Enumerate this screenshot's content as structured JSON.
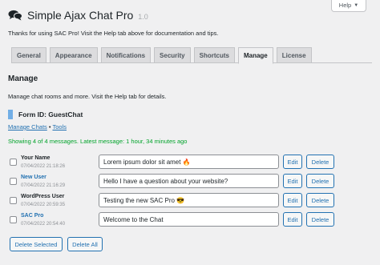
{
  "help_tab": {
    "label": "Help"
  },
  "header": {
    "title": "Simple Ajax Chat Pro",
    "version": "1.0",
    "intro": "Thanks for using SAC Pro! Visit the Help tab above for documentation and tips."
  },
  "tabs": [
    {
      "label": "General"
    },
    {
      "label": "Appearance"
    },
    {
      "label": "Notifications"
    },
    {
      "label": "Security"
    },
    {
      "label": "Shortcuts"
    },
    {
      "label": "Manage",
      "active": true
    },
    {
      "label": "License"
    }
  ],
  "manage": {
    "title": "Manage",
    "description": "Manage chat rooms and more. Visit the Help tab for details.",
    "form_id": "Form ID: GuestChat",
    "links": {
      "manage_chats": "Manage Chats",
      "separator": "•",
      "tools": "Tools"
    },
    "status": "Showing 4 of 4 messages. Latest message: 1 hour, 34 minutes ago"
  },
  "messages": [
    {
      "user": "Your Name",
      "user_is_link": false,
      "date": "07/04/2022 21:18:26",
      "text": "Lorem ipsum dolor sit amet 🔥"
    },
    {
      "user": "New User",
      "user_is_link": true,
      "date": "07/04/2022 21:16:29",
      "text": "Hello I have a question about your website?"
    },
    {
      "user": "WordPress User",
      "user_is_link": false,
      "date": "07/04/2022 20:59:35",
      "text": "Testing the new SAC Pro 😎"
    },
    {
      "user": "SAC Pro",
      "user_is_link": true,
      "date": "07/04/2022 20:54:40",
      "text": "Welcome to the Chat"
    }
  ],
  "row_buttons": {
    "edit": "Edit",
    "delete": "Delete"
  },
  "bulk_buttons": {
    "delete_selected": "Delete Selected",
    "delete_all": "Delete All"
  },
  "colors": {
    "accent": "#2271b1",
    "status": "#00a32a",
    "form_bar": "#72aee6",
    "background": "#f0f0f1"
  }
}
